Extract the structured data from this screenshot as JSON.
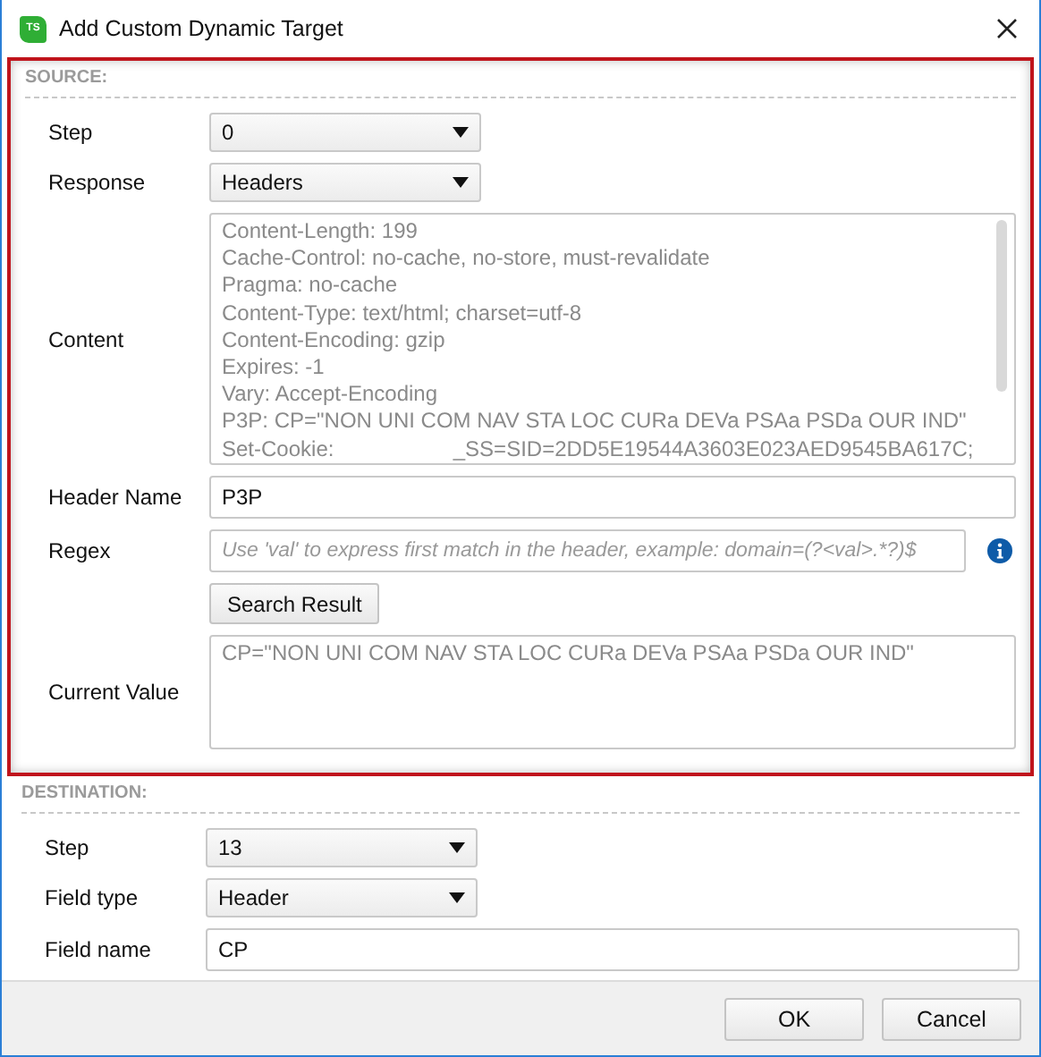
{
  "window": {
    "title": "Add Custom Dynamic Target",
    "app_icon": "TS"
  },
  "source": {
    "heading": "SOURCE:",
    "highlighted": true,
    "fields": [
      {
        "kind": "dropdown",
        "label": "Step",
        "value": "0"
      },
      {
        "kind": "dropdown",
        "label": "Response",
        "value": "Headers"
      },
      {
        "kind": "textarea",
        "label": "Content",
        "lines": [
          "Content-Length: 199",
          "Cache-Control: no-cache, no-store, must-revalidate",
          "Pragma: no-cache",
          "Content-Type: text/html; charset=utf-8",
          "Content-Encoding: gzip",
          "Expires: -1",
          "Vary: Accept-Encoding",
          "P3P: CP=\"NON UNI COM NAV STA LOC CURa DEVa PSAa PSDa OUR IND\"",
          "Set-Cookie:                    _SS=SID=2DD5E19544A3603E023AED9545BA617C;"
        ]
      },
      {
        "kind": "text",
        "label": "Header Name",
        "value": "P3P"
      },
      {
        "kind": "regex",
        "label": "Regex",
        "placeholder": "Use 'val' to express first match in the header, example: domain=(?<val>.*?)$",
        "button": "Search Result"
      },
      {
        "kind": "result",
        "label": "Current Value",
        "value": "CP=\"NON UNI COM NAV STA LOC CURa DEVa PSAa PSDa OUR IND\""
      }
    ]
  },
  "destination": {
    "heading": "DESTINATION:",
    "highlighted": false,
    "fields": [
      {
        "kind": "dropdown",
        "label": "Step",
        "value": "13"
      },
      {
        "kind": "dropdown",
        "label": "Field type",
        "value": "Header"
      },
      {
        "kind": "text",
        "label": "Field name",
        "value": "CP"
      }
    ]
  },
  "buttons": [
    "OK",
    "Cancel"
  ]
}
